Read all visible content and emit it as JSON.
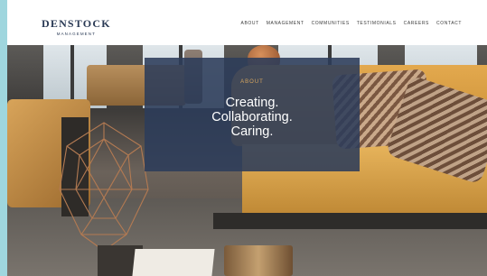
{
  "logo": {
    "main": "DENSTOCK",
    "sub": "MANAGEMENT"
  },
  "nav": [
    "ABOUT",
    "MANAGEMENT",
    "COMMUNITIES",
    "TESTIMONIALS",
    "CAREERS",
    "CONTACT"
  ],
  "hero": {
    "kicker": "ABOUT",
    "lines": [
      "Creating.",
      "Collaborating.",
      "Caring."
    ]
  },
  "colors": {
    "accent": "#d7a65e",
    "overlay": "#2c3c5a",
    "brand": "#2a3a55"
  }
}
